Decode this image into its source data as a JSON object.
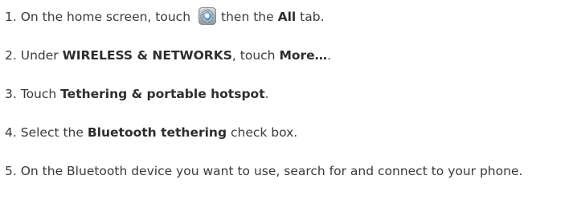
{
  "steps": [
    {
      "number": "1.",
      "text_1": "On the home screen, touch",
      "icon": "settings-icon",
      "text_2": "then the",
      "bold_1": "All",
      "text_3": "tab."
    },
    {
      "number": "2.",
      "text_1": "Under",
      "bold_1": "WIRELESS & NETWORKS",
      "text_2": ", touch",
      "bold_2": "More…",
      "text_3": "."
    },
    {
      "number": "3.",
      "text_1": "Touch",
      "bold_1": "Tethering & portable hotspot",
      "text_2": "."
    },
    {
      "number": "4.",
      "text_1": "Select the",
      "bold_1": "Bluetooth tethering",
      "text_2": "check box."
    },
    {
      "number": "5.",
      "text_1": "On the Bluetooth device you want to use, search for and connect to your phone."
    }
  ]
}
